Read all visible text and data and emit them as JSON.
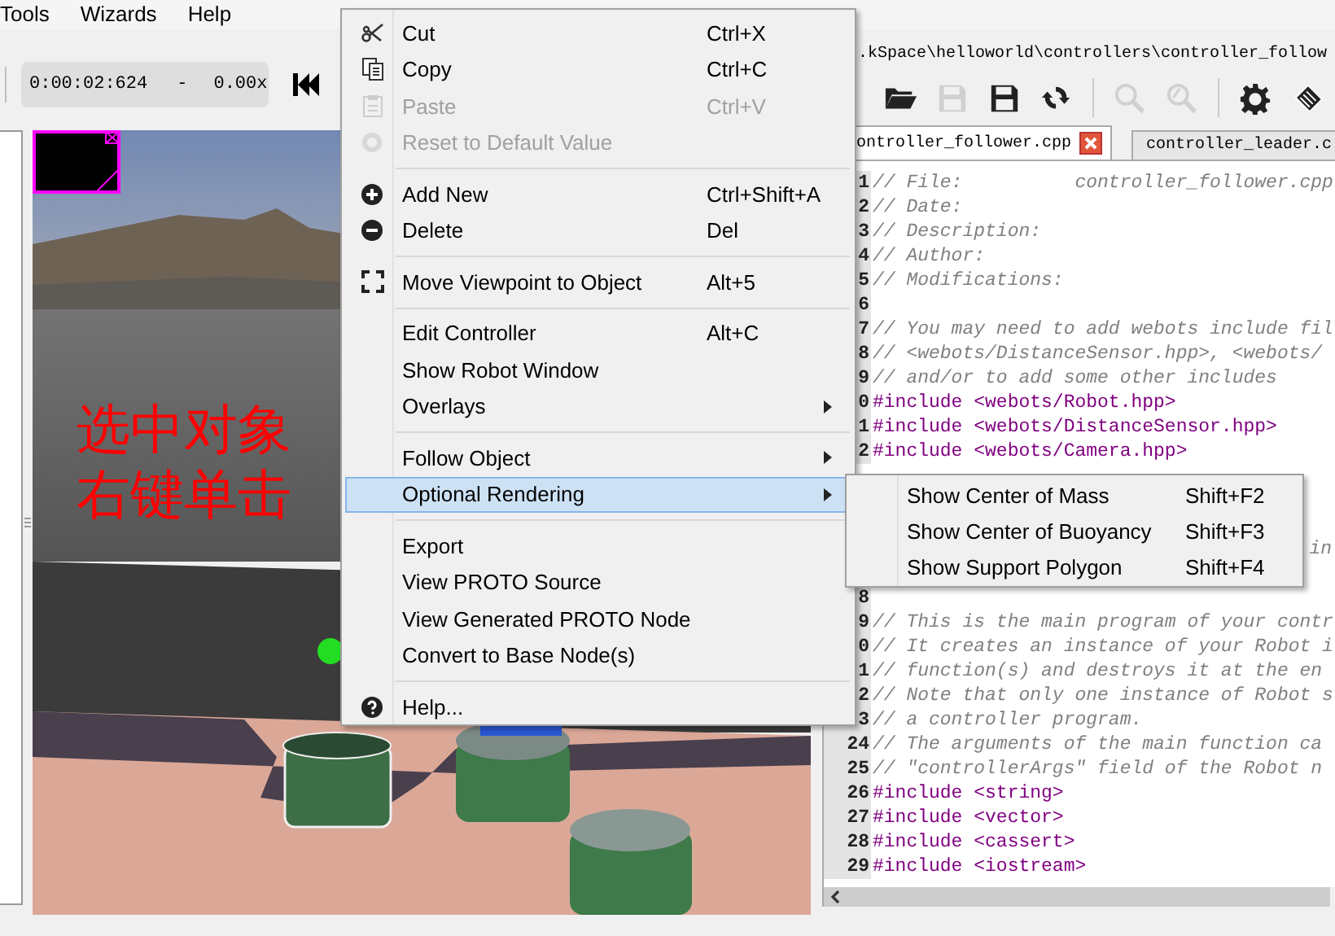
{
  "menubar": [
    {
      "label": "Tools"
    },
    {
      "label": "Wizards"
    },
    {
      "label": "Help"
    }
  ],
  "simulation": {
    "time": "0:00:02:624",
    "separator": "-",
    "speed": "0.00x"
  },
  "view": {
    "kind": "picture",
    "annotation": [
      "选中对象",
      "右键单击"
    ]
  },
  "editor": {
    "path": ".kSpace\\helloworld\\controllers\\controller_follow",
    "toolbar": [
      {
        "kind": "button",
        "disabled": false
      },
      {
        "kind": "button",
        "disabled": true
      },
      {
        "kind": "button",
        "disabled": false
      },
      {
        "kind": "button",
        "disabled": false
      },
      {
        "kind": "separator"
      },
      {
        "kind": "button",
        "disabled": true
      },
      {
        "kind": "button",
        "disabled": true
      },
      {
        "kind": "separator"
      },
      {
        "kind": "button",
        "disabled": false
      },
      {
        "kind": "button",
        "disabled": false
      }
    ],
    "tabs": [
      {
        "label": "ontroller_follower.cpp",
        "selected": true
      },
      {
        "label": "controller_leader.c",
        "selected": false
      }
    ],
    "lines": [
      {
        "kind": "comment",
        "number": "1",
        "text": "// File:          controller_follower.cpp"
      },
      {
        "kind": "comment",
        "number": "2",
        "text": "// Date:"
      },
      {
        "kind": "comment",
        "number": "3",
        "text": "// Description:"
      },
      {
        "kind": "comment",
        "number": "4",
        "text": "// Author:"
      },
      {
        "kind": "comment",
        "number": "5",
        "text": "// Modifications:"
      },
      {
        "kind": "blank",
        "number": "6"
      },
      {
        "kind": "comment",
        "number": "7",
        "text": "// You may need to add webots include fil"
      },
      {
        "kind": "comment",
        "number": "8",
        "text": "// <webots/DistanceSensor.hpp>, <webots/"
      },
      {
        "kind": "comment",
        "number": "9",
        "text": "// and/or to add some other includes"
      },
      {
        "kind": "include",
        "number": "0",
        "text": "#include <webots/Robot.hpp>"
      },
      {
        "kind": "include",
        "number": "1",
        "text": "#include <webots/DistanceSensor.hpp>"
      },
      {
        "kind": "include",
        "number": "2",
        "text": "#include <webots/Camera.hpp>"
      },
      {
        "kind": "covered"
      },
      {
        "kind": "covered"
      },
      {
        "kind": "covered"
      },
      {
        "kind": "fragment",
        "text": "in"
      },
      {
        "kind": "covered"
      },
      {
        "kind": "blank",
        "number": "8"
      },
      {
        "kind": "comment",
        "number": "9",
        "text": "// This is the main program of your contr"
      },
      {
        "kind": "comment",
        "number": "0",
        "text": "// It creates an instance of your Robot i"
      },
      {
        "kind": "comment",
        "number": "1",
        "text": "// function(s) and destroys it at the en"
      },
      {
        "kind": "comment",
        "number": "2",
        "text": "// Note that only one instance of Robot s"
      },
      {
        "kind": "comment",
        "number": "3",
        "text": "// a controller program."
      },
      {
        "kind": "comment",
        "number": "24",
        "text": "// The arguments of the main function ca"
      },
      {
        "kind": "comment",
        "number": "25",
        "text": "// \"controllerArgs\" field of the Robot n"
      },
      {
        "kind": "include",
        "number": "26",
        "text": "#include <string>"
      },
      {
        "kind": "include",
        "number": "27",
        "text": "#include <vector>"
      },
      {
        "kind": "include",
        "number": "28",
        "text": "#include <cassert>"
      },
      {
        "kind": "include",
        "number": "29",
        "text": "#include <iostream>"
      }
    ]
  },
  "context_menu": {
    "items": [
      {
        "kind": "item",
        "label": "Cut",
        "shortcut": "Ctrl+X",
        "disabled": false,
        "selected": false,
        "submenu": false
      },
      {
        "kind": "item",
        "label": "Copy",
        "shortcut": "Ctrl+C",
        "disabled": false,
        "selected": false,
        "submenu": false
      },
      {
        "kind": "item",
        "label": "Paste",
        "shortcut": "Ctrl+V",
        "disabled": true,
        "selected": false,
        "submenu": false
      },
      {
        "kind": "item",
        "label": "Reset to Default Value",
        "disabled": true,
        "selected": false,
        "submenu": false
      },
      {
        "kind": "separator"
      },
      {
        "kind": "item",
        "label": "Add New",
        "shortcut": "Ctrl+Shift+A",
        "disabled": false,
        "selected": false,
        "submenu": false
      },
      {
        "kind": "item",
        "label": "Delete",
        "shortcut": "Del",
        "disabled": false,
        "selected": false,
        "submenu": false
      },
      {
        "kind": "separator"
      },
      {
        "kind": "item",
        "label": "Move Viewpoint to Object",
        "shortcut": "Alt+5",
        "disabled": false,
        "selected": false,
        "submenu": false
      },
      {
        "kind": "separator"
      },
      {
        "kind": "item",
        "label": "Edit Controller",
        "shortcut": "Alt+C",
        "disabled": false,
        "selected": false,
        "submenu": false
      },
      {
        "kind": "item",
        "label": "Show Robot Window",
        "disabled": false,
        "selected": false,
        "submenu": false
      },
      {
        "kind": "item",
        "label": "Overlays",
        "disabled": false,
        "selected": false,
        "submenu": true
      },
      {
        "kind": "separator"
      },
      {
        "kind": "item",
        "label": "Follow Object",
        "disabled": false,
        "selected": false,
        "submenu": true
      },
      {
        "kind": "item",
        "label": "Optional Rendering",
        "disabled": false,
        "selected": true,
        "submenu": true
      },
      {
        "kind": "separator"
      },
      {
        "kind": "item",
        "label": "Export",
        "disabled": false,
        "selected": false,
        "submenu": false
      },
      {
        "kind": "item",
        "label": "View PROTO Source",
        "disabled": false,
        "selected": false,
        "submenu": false
      },
      {
        "kind": "item",
        "label": "View Generated PROTO Node",
        "disabled": false,
        "selected": false,
        "submenu": false
      },
      {
        "kind": "item",
        "label": "Convert to Base Node(s)",
        "disabled": false,
        "selected": false,
        "submenu": false
      },
      {
        "kind": "separator"
      },
      {
        "kind": "item",
        "label": "Help...",
        "disabled": false,
        "selected": false,
        "submenu": false
      }
    ]
  },
  "submenu": {
    "items": [
      {
        "label": "Show Center of Mass",
        "shortcut": "Shift+F2",
        "selected": false
      },
      {
        "label": "Show Center of Buoyancy",
        "shortcut": "Shift+F3",
        "selected": false
      },
      {
        "label": "Show Support Polygon",
        "shortcut": "Shift+F4",
        "selected": false
      }
    ]
  }
}
